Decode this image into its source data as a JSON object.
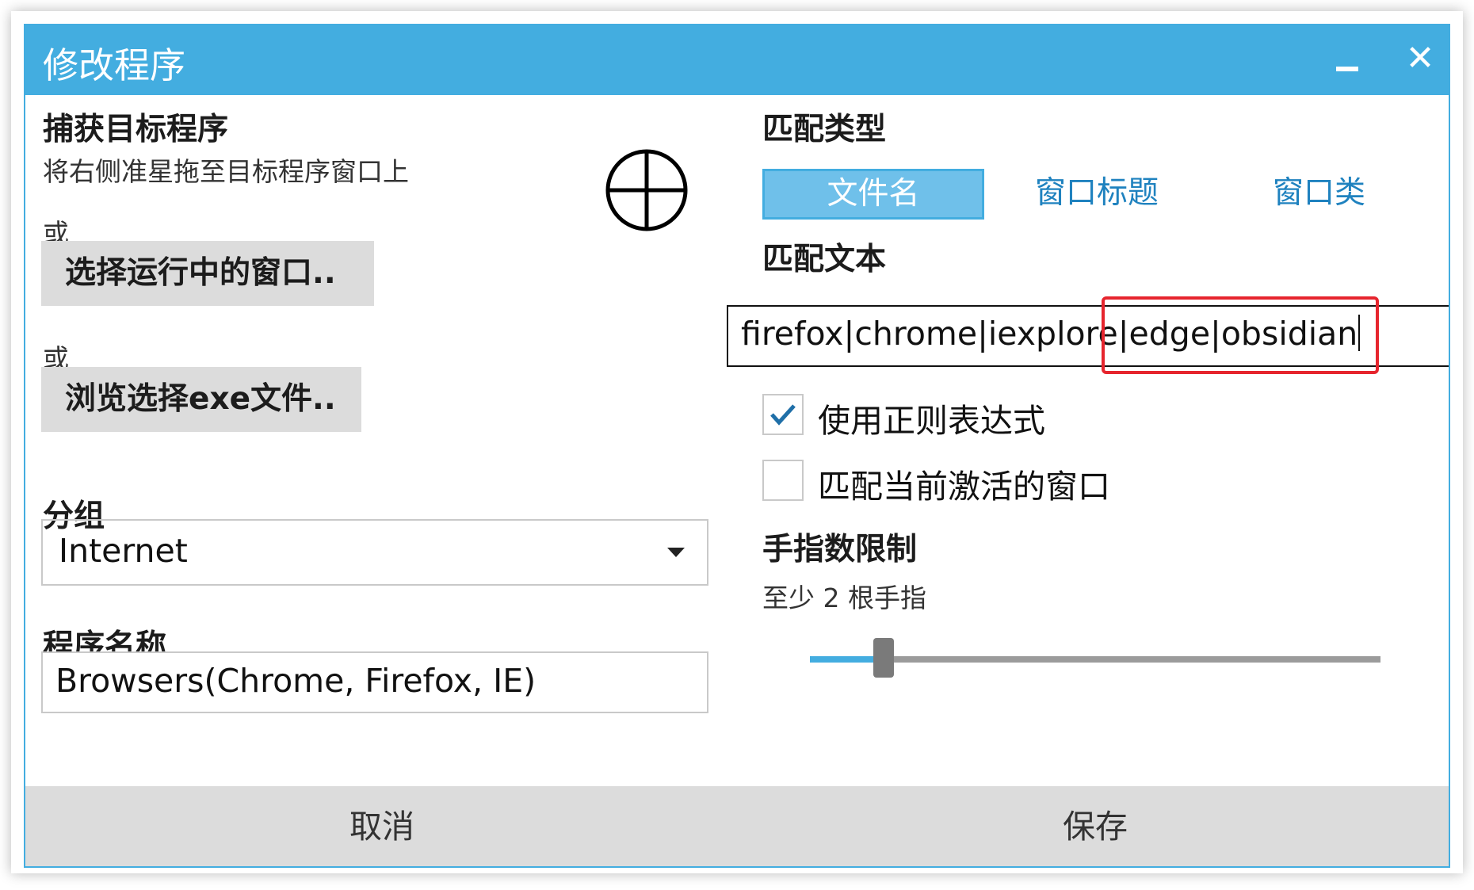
{
  "window": {
    "title": "修改程序",
    "close_glyph": "✕"
  },
  "left": {
    "capture_heading": "捕获目标程序",
    "capture_hint": "将右侧准星拖至目标程序窗口上",
    "or1": "或",
    "select_running_button": "选择运行中的窗口..",
    "or2": "或",
    "browse_exe_button": "浏览选择exe文件..",
    "group_heading": "分组",
    "group_value": "Internet",
    "name_heading": "程序名称",
    "name_value": "Browsers(Chrome, Firefox, IE)"
  },
  "right": {
    "match_type_heading": "匹配类型",
    "match_types": [
      "文件名",
      "窗口标题",
      "窗口类"
    ],
    "selected_match_type": "文件名",
    "match_text_heading": "匹配文本",
    "match_text_value": "firefox|chrome|iexplore|edge|obsidian",
    "use_regex_label": "使用正则表达式",
    "use_regex_checked": true,
    "match_active_label": "匹配当前激活的窗口",
    "match_active_checked": false,
    "finger_limit_heading": "手指数限制",
    "finger_limit_text": "至少 2 根手指",
    "finger_slider_value": 2
  },
  "footer": {
    "cancel": "取消",
    "save": "保存"
  },
  "icons": [
    "crosshair-icon",
    "minimize-icon",
    "close-icon",
    "checkmark-icon",
    "dropdown-arrow-icon"
  ],
  "colors": {
    "accent": "#43ade0",
    "selected_tab": "#6fc0ea",
    "link": "#1f82bf",
    "highlight": "#e6252e",
    "footer": "#dcdcdc"
  }
}
